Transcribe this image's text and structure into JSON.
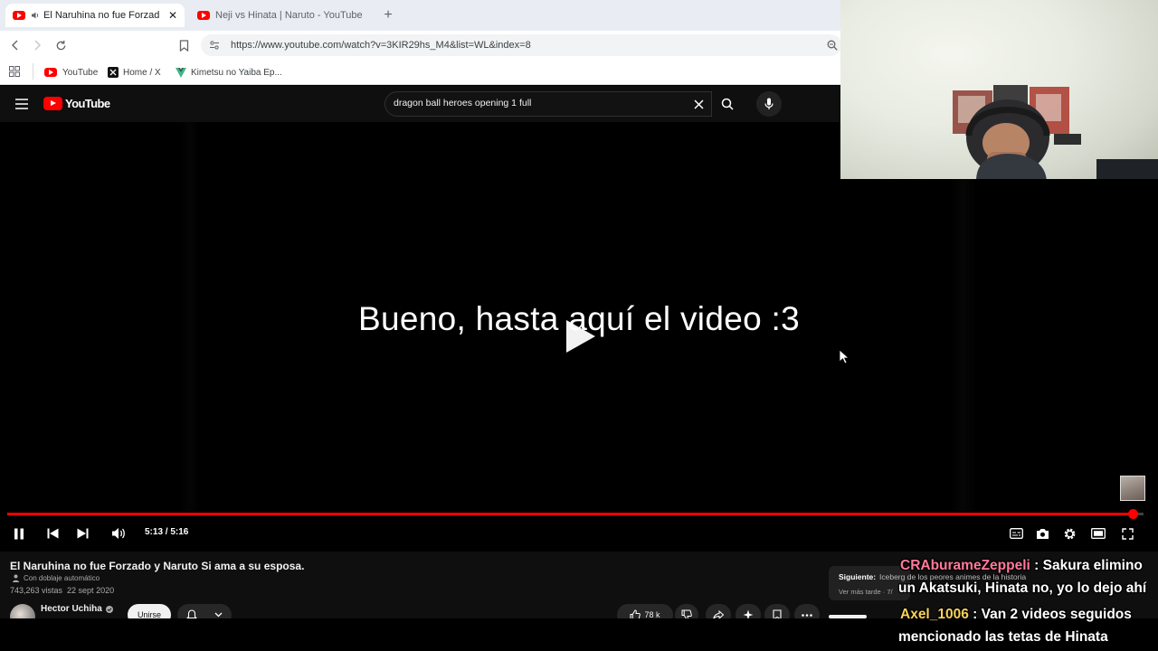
{
  "browser": {
    "tabs": [
      {
        "title": "El Naruhina no fue Forzado y",
        "active": true,
        "has_audio": true
      },
      {
        "title": "Neji vs Hinata | Naruto - YouTube",
        "active": false,
        "has_audio": false
      }
    ],
    "new_tab_label": "+",
    "url": "https://www.youtube.com/watch?v=3KIR29hs_M4&list=WL&index=8",
    "bookmarks": [
      {
        "label": "YouTube",
        "icon": "youtube-icon"
      },
      {
        "label": "Home / X",
        "icon": "x-logo-icon"
      },
      {
        "label": "Kimetsu no Yaiba Ep...",
        "icon": "vue-icon"
      }
    ]
  },
  "youtube": {
    "logo_text": "YouTube",
    "search_query": "dragon ball heroes opening 1 full"
  },
  "player": {
    "caption": "Bueno, hasta aquí el video :3",
    "current_time": "5:13",
    "duration": "5:16",
    "time_display": "5:13 / 5:16",
    "progress": 0.9905,
    "colors": {
      "progress": "#ff0000"
    }
  },
  "video_info": {
    "title": "El Naruhina no fue Forzado y Naruto Si ama a su esposa.",
    "dub_label": "Con doblaje automático",
    "stats": "743,263 vistas  22 sept 2020",
    "channel_name": "Hector Uchiha",
    "join_label": "Unirse",
    "like_count": "78 k"
  },
  "next_up": {
    "label": "Siguiente:",
    "title": "Iceberg de los peores animes de la historia",
    "more": "Ver más tarde · 7/"
  },
  "chat": [
    {
      "user": "CRAburameZeppeli",
      "line1": " : Sakura elimino",
      "line2": "un Akatsuki, Hinata no, yo lo dejo ahí",
      "color": "#ff7a9a"
    },
    {
      "user": "Axel_1006",
      "line1": " : Van 2 videos seguidos",
      "line2": "mencionado las tetas de Hinata",
      "color": "#f8d35a"
    }
  ]
}
